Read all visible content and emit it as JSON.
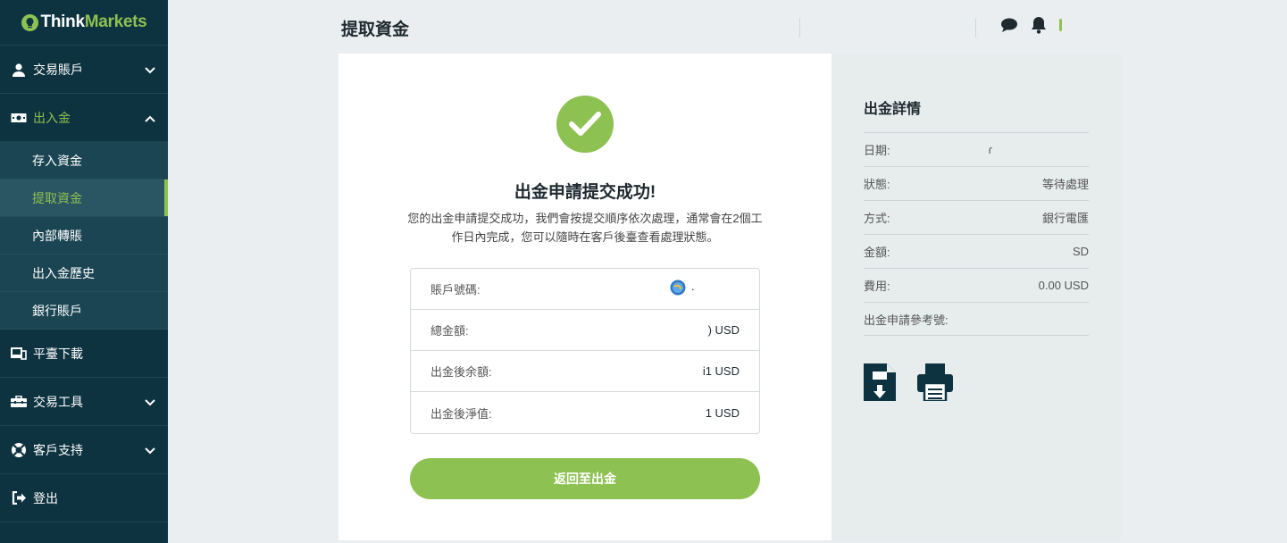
{
  "sidebar": {
    "logo": {
      "part1": "Think",
      "part2": "Markets"
    },
    "items": [
      {
        "label": "交易賬戶",
        "icon": "user-icon"
      },
      {
        "label": "出入金",
        "icon": "money-icon"
      },
      {
        "label": "平臺下載",
        "icon": "devices-icon"
      },
      {
        "label": "交易工具",
        "icon": "toolbox-icon"
      },
      {
        "label": "客戶支持",
        "icon": "lifebuoy-icon"
      },
      {
        "label": "登出",
        "icon": "logout-icon"
      }
    ],
    "sub_items": [
      {
        "label": "存入資金"
      },
      {
        "label": "提取資金"
      },
      {
        "label": "內部轉賬"
      },
      {
        "label": "出入金歷史"
      },
      {
        "label": "銀行賬戶"
      }
    ]
  },
  "header": {
    "title": "提取資金"
  },
  "main": {
    "success_title": "出金申請提交成功!",
    "success_desc": "您的出金申請提交成功，我們會按提交順序依次處理，通常會在2個工作日內完成，您可以隨時在客戶後臺查看處理狀態。",
    "summary": [
      {
        "label": "賬戶號碼:",
        "value": "·"
      },
      {
        "label": "總金額:",
        "value": ") USD"
      },
      {
        "label": "出金後余額:",
        "value": "i1 USD"
      },
      {
        "label": "出金後淨值:",
        "value": "1 USD"
      }
    ],
    "back_button": "返回至出金"
  },
  "details": {
    "title": "出金詳情",
    "rows": [
      {
        "label": "日期:",
        "value": "ɾ"
      },
      {
        "label": "狀態:",
        "value": "等待處理"
      },
      {
        "label": "方式:",
        "value": "銀行電匯"
      },
      {
        "label": "金額:",
        "value": "SD"
      },
      {
        "label": "費用:",
        "value": "0.00 USD"
      },
      {
        "label": "出金申請參考號:",
        "value": ""
      }
    ]
  },
  "colors": {
    "accent": "#8dc152",
    "sidebar": "#0e3340",
    "panel": "#e7eced"
  }
}
